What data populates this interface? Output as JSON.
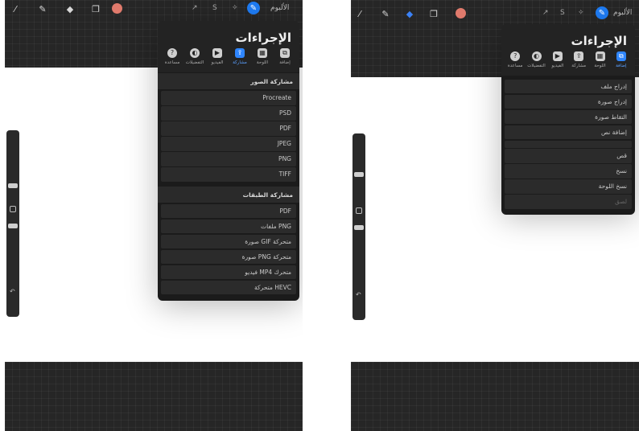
{
  "left": {
    "toolbar": {
      "gallery": "الألبوم",
      "tool_icons": [
        "brush-icon",
        "smudge-icon",
        "eraser-icon",
        "layers-icon"
      ]
    },
    "actions_title": "الإجراءات",
    "tabs": [
      {
        "label": "إضافة",
        "icon": "add-icon",
        "glyph": "⧉"
      },
      {
        "label": "اللوحة",
        "icon": "canvas-icon",
        "glyph": "▦"
      },
      {
        "label": "مشاركة",
        "icon": "share-icon",
        "glyph": "⇪"
      },
      {
        "label": "الفيديو",
        "icon": "video-icon",
        "glyph": "▶"
      },
      {
        "label": "التفضيلات",
        "icon": "prefs-icon",
        "glyph": "◐"
      },
      {
        "label": "مساعدة",
        "icon": "help-icon",
        "glyph": "?"
      }
    ],
    "active_tab": "مشاركة",
    "section_image": "مشاركة الصور",
    "image_items": [
      "Procreate",
      "PSD",
      "PDF",
      "JPEG",
      "PNG",
      "TIFF"
    ],
    "section_layers": "مشاركة الطبقات",
    "layer_items": [
      "PDF",
      "ملفات PNG",
      "صورة GIF متحركة",
      "صورة PNG متحركة",
      "فيديو MP4 متحرك",
      "متحركة HEVC"
    ]
  },
  "right": {
    "toolbar": {
      "gallery": "الألبوم",
      "tool_icons": [
        "brush-icon",
        "smudge-icon",
        "eraser-icon",
        "layers-icon"
      ]
    },
    "actions_title": "الإجراءات",
    "tabs": [
      {
        "label": "إضافة",
        "icon": "add-icon",
        "glyph": "⧉"
      },
      {
        "label": "اللوحة",
        "icon": "canvas-icon",
        "glyph": "▦"
      },
      {
        "label": "مشاركة",
        "icon": "share-icon",
        "glyph": "⇪"
      },
      {
        "label": "الفيديو",
        "icon": "video-icon",
        "glyph": "▶"
      },
      {
        "label": "التفضيلات",
        "icon": "prefs-icon",
        "glyph": "◐"
      },
      {
        "label": "مساعدة",
        "icon": "help-icon",
        "glyph": "?"
      }
    ],
    "active_tab": "إضافة",
    "insert_items": [
      "إدراج ملف",
      "إدراج صورة",
      "التقاط صورة",
      "إضافة نص"
    ],
    "edit_items": [
      "قص",
      "نسخ",
      "نسخ اللوحة",
      "لصق"
    ],
    "disabled_item": "لصق"
  },
  "colors": {
    "accent": "#2f86ff",
    "panel": "#232323",
    "current_color": "#e07a6c"
  }
}
